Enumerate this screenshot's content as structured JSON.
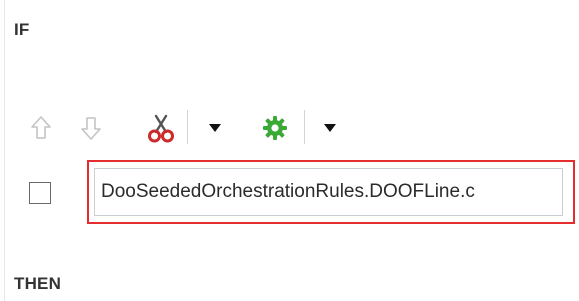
{
  "sections": {
    "if_label": "IF",
    "then_label": "THEN"
  },
  "toolbar": {
    "move_up_icon": "arrow-up-outline",
    "move_down_icon": "arrow-down-outline",
    "cut_icon": "scissors",
    "cut_menu_icon": "caret-down",
    "settings_icon": "gear",
    "settings_menu_icon": "caret-down"
  },
  "condition": {
    "checked": false,
    "value": "DooSeededOrchestrationRules.DOOFLine.c",
    "highlight_color": "#e52d2d"
  },
  "colors": {
    "scissors_handles": "#cc2a2a",
    "gear": "#3aa935",
    "disabled_arrows": "#c4c4c4"
  }
}
